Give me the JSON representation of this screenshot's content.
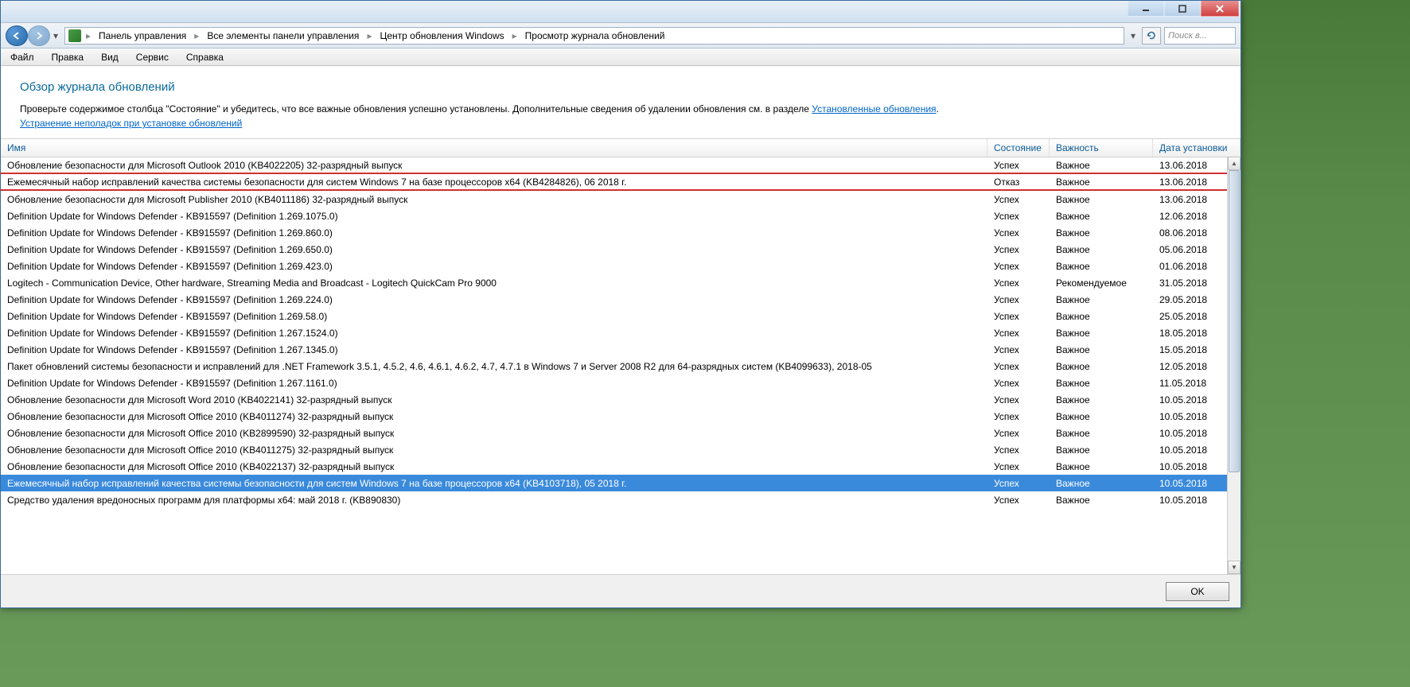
{
  "titlebar": {},
  "breadcrumbs": {
    "items": [
      "Панель управления",
      "Все элементы панели управления",
      "Центр обновления Windows",
      "Просмотр журнала обновлений"
    ]
  },
  "search": {
    "placeholder": "Поиск в..."
  },
  "menu": {
    "file": "Файл",
    "edit": "Правка",
    "view": "Вид",
    "service": "Сервис",
    "help": "Справка"
  },
  "header": {
    "title": "Обзор журнала обновлений",
    "subtitle_prefix": "Проверьте содержимое столбца \"Состояние\" и убедитесь, что все важные обновления успешно установлены. Дополнительные сведения об удалении обновления см. в разделе ",
    "link1": "Установленные обновления",
    "link2": "Устранение неполадок при установке обновлений"
  },
  "columns": {
    "name": "Имя",
    "state": "Состояние",
    "importance": "Важность",
    "date": "Дата установки"
  },
  "rows": [
    {
      "name": "Обновление безопасности для Microsoft Outlook 2010 (KB4022205) 32-разрядный выпуск",
      "state": "Успех",
      "importance": "Важное",
      "date": "13.06.2018",
      "underlined": true
    },
    {
      "name": "Ежемесячный набор исправлений качества системы безопасности для систем Windows 7 на базе процессоров x64 (KB4284826), 06 2018 г.",
      "state": "Отказ",
      "importance": "Важное",
      "date": "13.06.2018",
      "underlined": true
    },
    {
      "name": "Обновление безопасности для Microsoft Publisher 2010 (KB4011186) 32-разрядный выпуск",
      "state": "Успех",
      "importance": "Важное",
      "date": "13.06.2018"
    },
    {
      "name": "Definition Update for Windows Defender - KB915597 (Definition 1.269.1075.0)",
      "state": "Успех",
      "importance": "Важное",
      "date": "12.06.2018"
    },
    {
      "name": "Definition Update for Windows Defender - KB915597 (Definition 1.269.860.0)",
      "state": "Успех",
      "importance": "Важное",
      "date": "08.06.2018"
    },
    {
      "name": "Definition Update for Windows Defender - KB915597 (Definition 1.269.650.0)",
      "state": "Успех",
      "importance": "Важное",
      "date": "05.06.2018"
    },
    {
      "name": "Definition Update for Windows Defender - KB915597 (Definition 1.269.423.0)",
      "state": "Успех",
      "importance": "Важное",
      "date": "01.06.2018"
    },
    {
      "name": "Logitech - Communication Device, Other hardware, Streaming Media and Broadcast - Logitech QuickCam Pro 9000",
      "state": "Успех",
      "importance": "Рекомендуемое",
      "date": "31.05.2018"
    },
    {
      "name": "Definition Update for Windows Defender - KB915597 (Definition 1.269.224.0)",
      "state": "Успех",
      "importance": "Важное",
      "date": "29.05.2018"
    },
    {
      "name": "Definition Update for Windows Defender - KB915597 (Definition 1.269.58.0)",
      "state": "Успех",
      "importance": "Важное",
      "date": "25.05.2018"
    },
    {
      "name": "Definition Update for Windows Defender - KB915597 (Definition 1.267.1524.0)",
      "state": "Успех",
      "importance": "Важное",
      "date": "18.05.2018"
    },
    {
      "name": "Definition Update for Windows Defender - KB915597 (Definition 1.267.1345.0)",
      "state": "Успех",
      "importance": "Важное",
      "date": "15.05.2018"
    },
    {
      "name": "Пакет обновлений системы безопасности и исправлений для .NET Framework 3.5.1, 4.5.2, 4.6, 4.6.1, 4.6.2, 4.7, 4.7.1 в Windows 7 и Server 2008 R2 для 64-разрядных систем (KB4099633), 2018-05",
      "state": "Успех",
      "importance": "Важное",
      "date": "12.05.2018"
    },
    {
      "name": "Definition Update for Windows Defender - KB915597 (Definition 1.267.1161.0)",
      "state": "Успех",
      "importance": "Важное",
      "date": "11.05.2018"
    },
    {
      "name": "Обновление безопасности для Microsoft Word 2010 (KB4022141) 32-разрядный выпуск",
      "state": "Успех",
      "importance": "Важное",
      "date": "10.05.2018"
    },
    {
      "name": "Обновление безопасности для Microsoft Office 2010 (KB4011274) 32-разрядный выпуск",
      "state": "Успех",
      "importance": "Важное",
      "date": "10.05.2018"
    },
    {
      "name": "Обновление безопасности для Microsoft Office 2010 (KB2899590) 32-разрядный выпуск",
      "state": "Успех",
      "importance": "Важное",
      "date": "10.05.2018"
    },
    {
      "name": "Обновление безопасности для Microsoft Office 2010 (KB4011275) 32-разрядный выпуск",
      "state": "Успех",
      "importance": "Важное",
      "date": "10.05.2018"
    },
    {
      "name": "Обновление безопасности для Microsoft Office 2010 (KB4022137) 32-разрядный выпуск",
      "state": "Успех",
      "importance": "Важное",
      "date": "10.05.2018"
    },
    {
      "name": "Ежемесячный набор исправлений качества системы безопасности для систем Windows 7 на базе процессоров x64 (KB4103718), 05 2018 г.",
      "state": "Успех",
      "importance": "Важное",
      "date": "10.05.2018",
      "selected": true
    },
    {
      "name": "Средство удаления вредоносных программ для платформы x64: май 2018 г. (KB890830)",
      "state": "Успех",
      "importance": "Важное",
      "date": "10.05.2018"
    }
  ],
  "footer": {
    "ok": "OK"
  }
}
